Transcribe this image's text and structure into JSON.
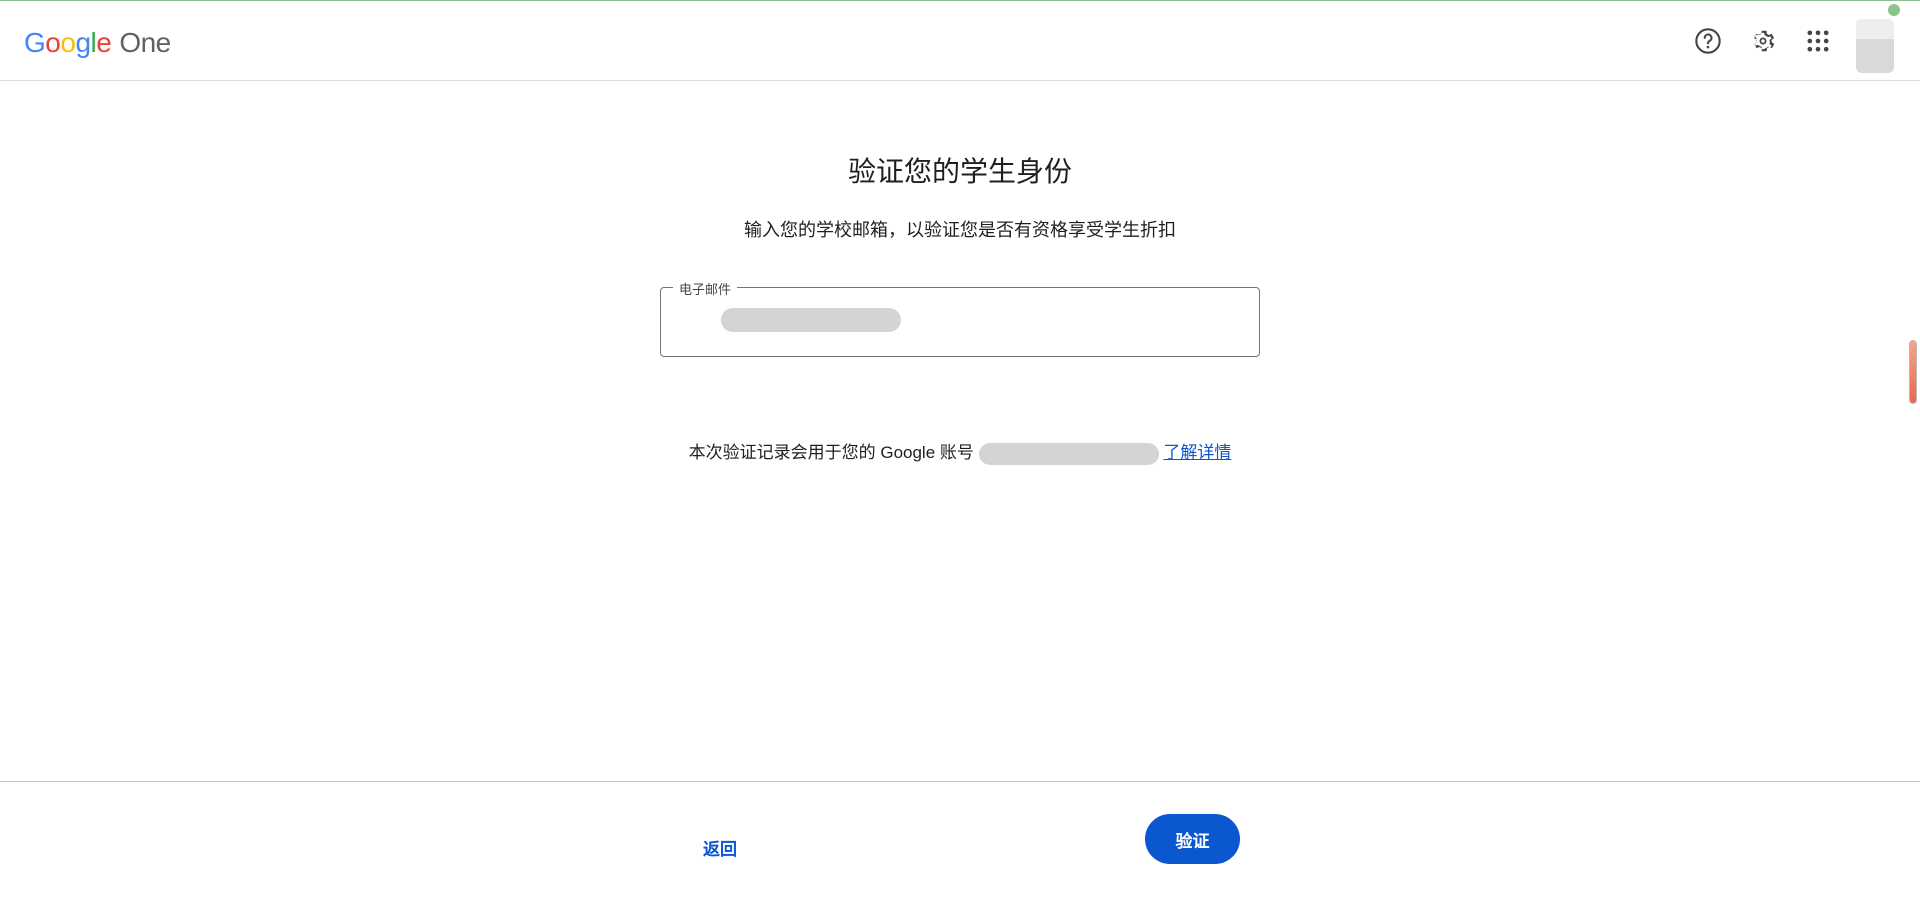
{
  "header": {
    "logo_letters": [
      "G",
      "o",
      "o",
      "g",
      "l",
      "e"
    ],
    "product": "One",
    "icons": [
      "help-icon",
      "gear-icon",
      "apps-grid-icon"
    ]
  },
  "main": {
    "title": "验证您的学生身份",
    "subtitle": "输入您的学校邮箱，以验证您是否有资格享受学生折扣",
    "email_field": {
      "label": "电子邮件",
      "value": ""
    },
    "notice_prefix": "本次验证记录会用于您的 Google 账号",
    "learn_more": "了解详情"
  },
  "footer": {
    "back_label": "返回",
    "verify_label": "验证"
  },
  "colors": {
    "primary": "#0b57d0",
    "border": "#747775"
  }
}
